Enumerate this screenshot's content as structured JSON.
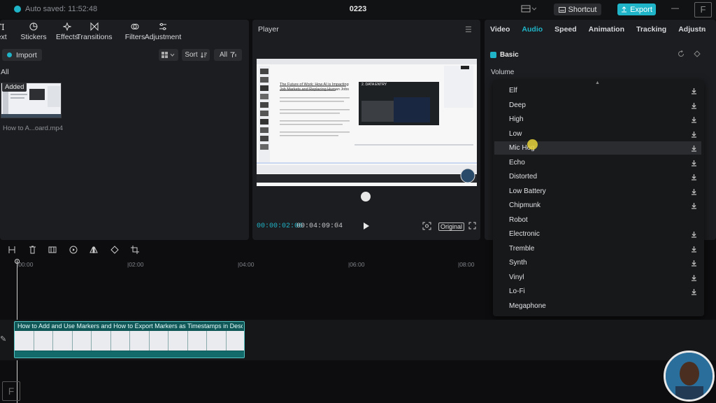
{
  "topbar": {
    "autosave": "Auto saved: 11:52:48",
    "project_title": "0223",
    "shortcut_label": "Shortcut",
    "export_label": "Export"
  },
  "media_tabs": [
    {
      "label": "Text",
      "icon": "text-icon"
    },
    {
      "label": "Stickers",
      "icon": "sticker-icon"
    },
    {
      "label": "Effects",
      "icon": "effects-icon"
    },
    {
      "label": "Transitions",
      "icon": "transitions-icon"
    },
    {
      "label": "Filters",
      "icon": "filters-icon"
    },
    {
      "label": "Adjustment",
      "icon": "adjustment-icon"
    }
  ],
  "media": {
    "import_label": "Import",
    "sort_label": "Sort",
    "filter_label": "All",
    "section_label": "All",
    "item_badge": "Added",
    "item_name": "How to A...oard.mp4"
  },
  "player": {
    "title": "Player",
    "current_time": "00:00:02:06",
    "total_time": "00:04:09:04",
    "original_label": "Original",
    "viewer_doc_title": "The Future of Work: How AI is Impacting Job Markets and Replacing Human Jobs",
    "viewer_tag": "2. DATA ENTRY"
  },
  "props": {
    "tabs": [
      {
        "label": "Video",
        "active": false
      },
      {
        "label": "Audio",
        "active": true
      },
      {
        "label": "Speed",
        "active": false
      },
      {
        "label": "Animation",
        "active": false
      },
      {
        "label": "Tracking",
        "active": false
      },
      {
        "label": "Adjustn",
        "active": false
      }
    ],
    "basic_label": "Basic",
    "volume_label": "Volume"
  },
  "voice_options": [
    {
      "label": "Elf",
      "download": true,
      "hover": false
    },
    {
      "label": "Deep",
      "download": true,
      "hover": false
    },
    {
      "label": "High",
      "download": true,
      "hover": false
    },
    {
      "label": "Low",
      "download": true,
      "hover": false
    },
    {
      "label": "Mic Hog",
      "download": true,
      "hover": true
    },
    {
      "label": "Echo",
      "download": true,
      "hover": false
    },
    {
      "label": "Distorted",
      "download": true,
      "hover": false
    },
    {
      "label": "Low Battery",
      "download": true,
      "hover": false
    },
    {
      "label": "Chipmunk",
      "download": true,
      "hover": false
    },
    {
      "label": "Robot",
      "download": false,
      "hover": false
    },
    {
      "label": "Electronic",
      "download": true,
      "hover": false
    },
    {
      "label": "Tremble",
      "download": true,
      "hover": false
    },
    {
      "label": "Synth",
      "download": true,
      "hover": false
    },
    {
      "label": "Vinyl",
      "download": true,
      "hover": false
    },
    {
      "label": "Lo-Fi",
      "download": true,
      "hover": false
    },
    {
      "label": "Megaphone",
      "download": false,
      "hover": false
    }
  ],
  "timeline": {
    "ticks": [
      "00:00",
      "02:00",
      "04:00",
      "06:00",
      "08:00"
    ],
    "clip_title": "How to Add and Use Markers and How to Export Markers as Timestamps in Descript"
  },
  "colors": {
    "accent": "#1fb4c7",
    "clip": "#0f5656",
    "panel": "#1c1d20"
  }
}
